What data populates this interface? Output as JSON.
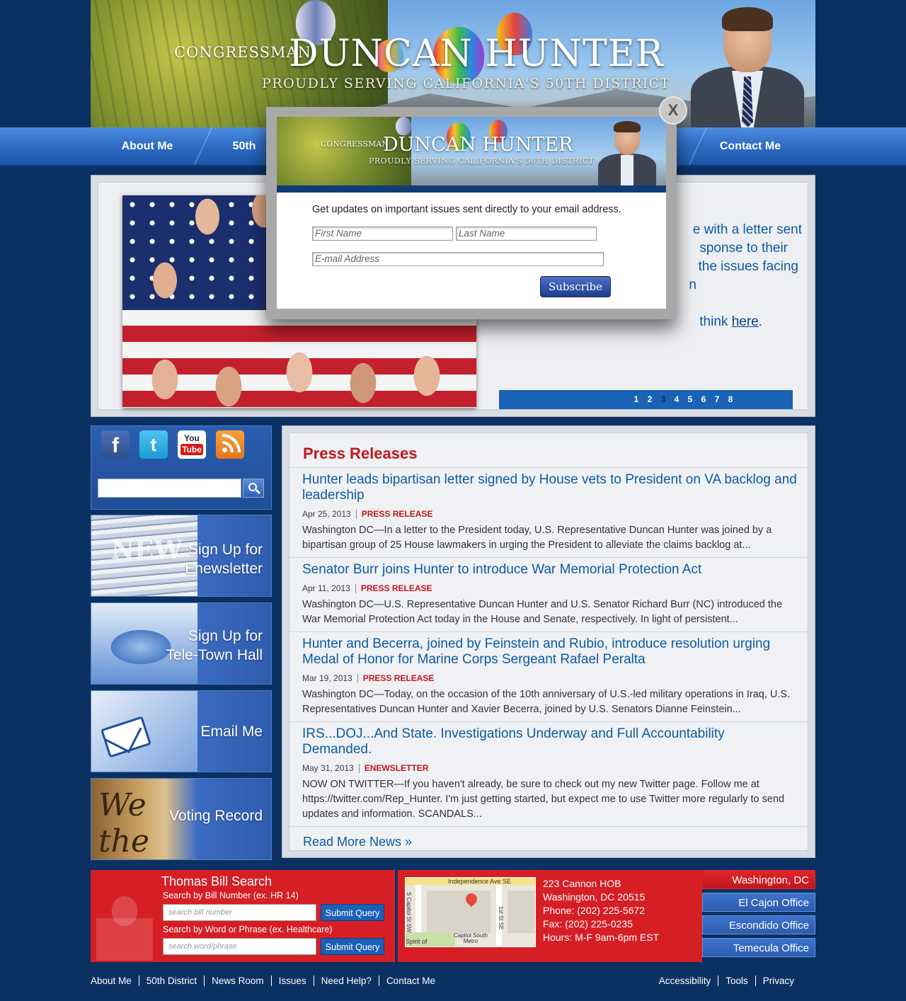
{
  "header": {
    "congressman": "CONGRESSMAN",
    "name": "DUNCAN HUNTER",
    "tagline": "PROUDLY SERVING CALIFORNIA'S 50TH DISTRICT"
  },
  "nav": {
    "items": [
      "About Me",
      "50th",
      "Contact Me"
    ]
  },
  "feature": {
    "lines": [
      "e with a letter sent",
      "sponse to their",
      "the issues facing",
      "n"
    ],
    "last_prefix": "think ",
    "link": "here",
    "last_suffix": ".",
    "pager": [
      "1",
      "2",
      "3",
      "4",
      "5",
      "6",
      "7",
      "8"
    ],
    "pager_active": "3"
  },
  "social": {
    "icons": [
      "facebook-icon",
      "twitter-icon",
      "youtube-icon",
      "rss-icon"
    ],
    "youtube_you": "You",
    "youtube_tube": "Tube",
    "search_value": ""
  },
  "promos": {
    "newsletter": {
      "line1": "Sign Up for",
      "line2": "Enewsletter",
      "art_text": "NEW"
    },
    "telehall": {
      "line1": "Sign Up for",
      "line2": "Tele-Town Hall"
    },
    "email": {
      "line1": "Email Me"
    },
    "voting": {
      "line1": "Voting Record",
      "art_text": "We the"
    }
  },
  "press": {
    "heading": "Press Releases",
    "items": [
      {
        "title": "Hunter leads bipartisan letter signed by House vets to President on VA backlog and leadership",
        "date": "Apr 25, 2013",
        "category": "PRESS RELEASE",
        "desc": "Washington DC—In a letter to the President today, U.S. Representative Duncan Hunter was joined by a bipartisan group of 25 House lawmakers in urging the President to alleviate the claims backlog at..."
      },
      {
        "title": "Senator Burr joins Hunter to introduce War Memorial Protection Act",
        "date": "Apr 11, 2013",
        "category": "PRESS RELEASE",
        "desc": "Washington DC—U.S. Representative Duncan Hunter and U.S. Senator Richard Burr (NC) introduced the War Memorial Protection Act today in the House and Senate, respectively.  In light of persistent..."
      },
      {
        "title": "Hunter and Becerra, joined by Feinstein and Rubio, introduce resolution urging Medal of Honor for Marine Corps Sergeant Rafael Peralta",
        "date": "Mar 19, 2013",
        "category": "PRESS RELEASE",
        "desc": "Washington DC—Today, on the occasion of the 10th anniversary of U.S.-led military operations in Iraq, U.S. Representatives Duncan Hunter and Xavier Becerra, joined by U.S. Senators Dianne Feinstein..."
      },
      {
        "title": "IRS...DOJ...And State. Investigations Underway and Full Accountability Demanded.",
        "date": "May 31, 2013",
        "category": "ENEWSLETTER",
        "desc": "NOW ON TWITTER—If you haven't already, be sure to check out my new Twitter page.  Follow me at https://twitter.com/Rep_Hunter.  I'm just getting started, but expect me to use Twitter more regularly to send updates and information.    SCANDALS..."
      }
    ],
    "read_more": "Read More News »"
  },
  "thomas": {
    "title": "Thomas Bill Search",
    "bill_label": "Search by Bill Number (ex. HR 14)",
    "bill_placeholder": "search bill number",
    "word_label": "Search by Word or Phrase (ex. Healthcare)",
    "word_placeholder": "search word/phrase",
    "submit": "Submit Query"
  },
  "office": {
    "map_labels": {
      "top": "Independence Ave SE",
      "left": "S Capitol St SW",
      "right": "1st St SE",
      "metro": "Capitol South Metro",
      "park": "Spirit of"
    },
    "address": [
      "223 Cannon HOB",
      "Washington, DC 20515",
      "Phone: (202) 225-5672",
      "Fax: (202) 225-0235",
      "Hours: M-F 9am-6pm EST"
    ],
    "tabs": [
      "Washington, DC",
      "El Cajon Office",
      "Escondido Office",
      "Temecula Office"
    ],
    "active_tab": "Washington, DC"
  },
  "footer": {
    "left": [
      "About Me",
      "50th District",
      "News Room",
      "Issues",
      "Need Help?",
      "Contact Me"
    ],
    "right": [
      "Accessibility",
      "Tools",
      "Privacy"
    ]
  },
  "modal": {
    "close": "X",
    "banner_congressman": "CONGRESSMAN",
    "banner_name": "DUNCAN HUNTER",
    "banner_tagline": "PROUDLY SERVING CALIFORNIA'S 50TH DISTRICT",
    "message": "Get updates on important issues sent directly to your email address.",
    "first_placeholder": "First Name",
    "last_placeholder": "Last Name",
    "email_placeholder": "E-mail Address",
    "subscribe": "Subscribe"
  },
  "colors": {
    "page_bg": "#0b3163",
    "accent_red": "#c4161c",
    "link_blue": "#0c5ba7",
    "nav_blue": "#2f6ec8"
  }
}
